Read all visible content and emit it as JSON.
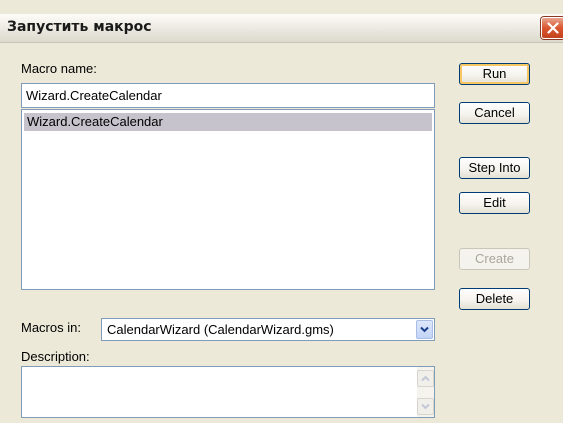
{
  "window": {
    "title": "Запустить макрос"
  },
  "macro_name": {
    "label": "Macro name:",
    "value": "Wizard.CreateCalendar"
  },
  "macro_list": {
    "items": [
      "Wizard.CreateCalendar"
    ],
    "selected_index": 0
  },
  "buttons": {
    "run": "Run",
    "cancel": "Cancel",
    "step_into": "Step Into",
    "edit": "Edit",
    "create": "Create",
    "delete": "Delete"
  },
  "macros_in": {
    "label": "Macros in:",
    "selected": "CalendarWizard (CalendarWizard.gms)"
  },
  "description": {
    "label": "Description:",
    "value": ""
  },
  "icons": {
    "close": "close-icon",
    "dropdown": "chevron-down-icon",
    "scroll_up": "chevron-up-icon",
    "scroll_down": "chevron-down-icon"
  },
  "colors": {
    "dialog_bg": "#ece9d8",
    "selection": "#c6c3cc",
    "close_button": "#d9562f",
    "default_button_focus": "#f6c663",
    "field_border": "#7f9db9"
  }
}
